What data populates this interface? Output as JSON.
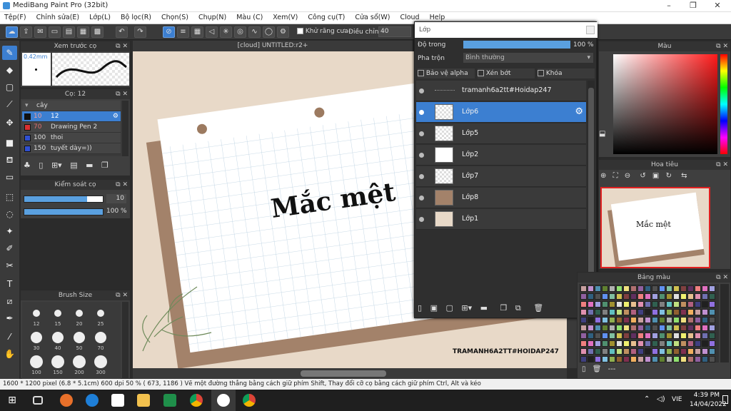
{
  "app": {
    "title": "MediBang Paint Pro (32bit)"
  },
  "menu": [
    "Tệp(F)",
    "Chỉnh sửa(E)",
    "Lớp(L)",
    "Bộ lọc(R)",
    "Chọn(S)",
    "Chụp(N)",
    "Màu (C)",
    "Xem(V)",
    "Công cụ(T)",
    "Cửa sổ(W)",
    "Cloud",
    "Help"
  ],
  "toolbar": {
    "antialias_label": "Khử răng cưa",
    "adjust_label": "Điều chỉnh",
    "adjust_value": "40"
  },
  "preview_panel": {
    "title": "Xem trước cọ",
    "size_label": "0.42mm"
  },
  "brush_panel": {
    "title": "Cọ: 12",
    "items": [
      {
        "size": "",
        "name": "cây",
        "color": "#888888"
      },
      {
        "size": "10",
        "name": "12",
        "color": "#111111"
      },
      {
        "size": "70",
        "name": "Drawing Pen 2",
        "color": "#d83030"
      },
      {
        "size": "100",
        "name": "thoi",
        "color": "#3050d0"
      },
      {
        "size": "150",
        "name": "tuyết dày=))",
        "color": "#3050d0"
      }
    ]
  },
  "brush_control": {
    "title": "Kiểm soát cọ",
    "size_value": "10",
    "opacity_value": "100 %",
    "opacity_fraction": 1.0,
    "size_fraction": 0.8
  },
  "brush_size_panel": {
    "title": "Brush Size",
    "labels_row1": [
      "12",
      "15",
      "20",
      "25"
    ],
    "labels_row2": [
      "30",
      "40",
      "50",
      "70"
    ],
    "labels_row3": [
      "100",
      "150",
      "200",
      "300"
    ]
  },
  "document": {
    "tab_title": "[cloud] UNTITLED:r2+",
    "canvas_text": "Mắc mệt",
    "watermark": "TRAMANH6A2TT#HOIDAP247"
  },
  "layer_panel": {
    "title": "Lớp",
    "opacity_label": "Độ trong",
    "opacity_value": "100 %",
    "opacity_fraction": 1.0,
    "blend_label": "Pha trộn",
    "blend_value": "Bình thường",
    "protect_alpha": "Bảo vệ alpha",
    "clip": "Xén bớt",
    "lock": "Khóa",
    "layers": [
      {
        "name": "tramanh6a2tt#Hoidap247",
        "selected": false
      },
      {
        "name": "Lớp6",
        "selected": true
      },
      {
        "name": "Lớp5",
        "selected": false
      },
      {
        "name": "Lớp2",
        "selected": false
      },
      {
        "name": "Lớp7",
        "selected": false
      },
      {
        "name": "Lớp8",
        "selected": false
      },
      {
        "name": "Lớp1",
        "selected": false
      }
    ]
  },
  "color_panel": {
    "title": "Màu"
  },
  "navigator": {
    "title": "Hoa tiêu",
    "thumb_text": "Mắc mệt"
  },
  "palette": {
    "title": "Bảng màu",
    "footer": "---"
  },
  "statusbar": {
    "text": "1600 * 1200 pixel   (6.8 * 5.1cm)   600 dpi   50 %   ( 673, 1186 )   Vẽ một đường thẳng bằng cách giữ phím Shift, Thay đổi cỡ cọ bằng cách giữ phím Ctrl, Alt và kéo"
  },
  "taskbar": {
    "time": "4:39 PM",
    "date": "14/04/2022",
    "lang": "VIE"
  }
}
